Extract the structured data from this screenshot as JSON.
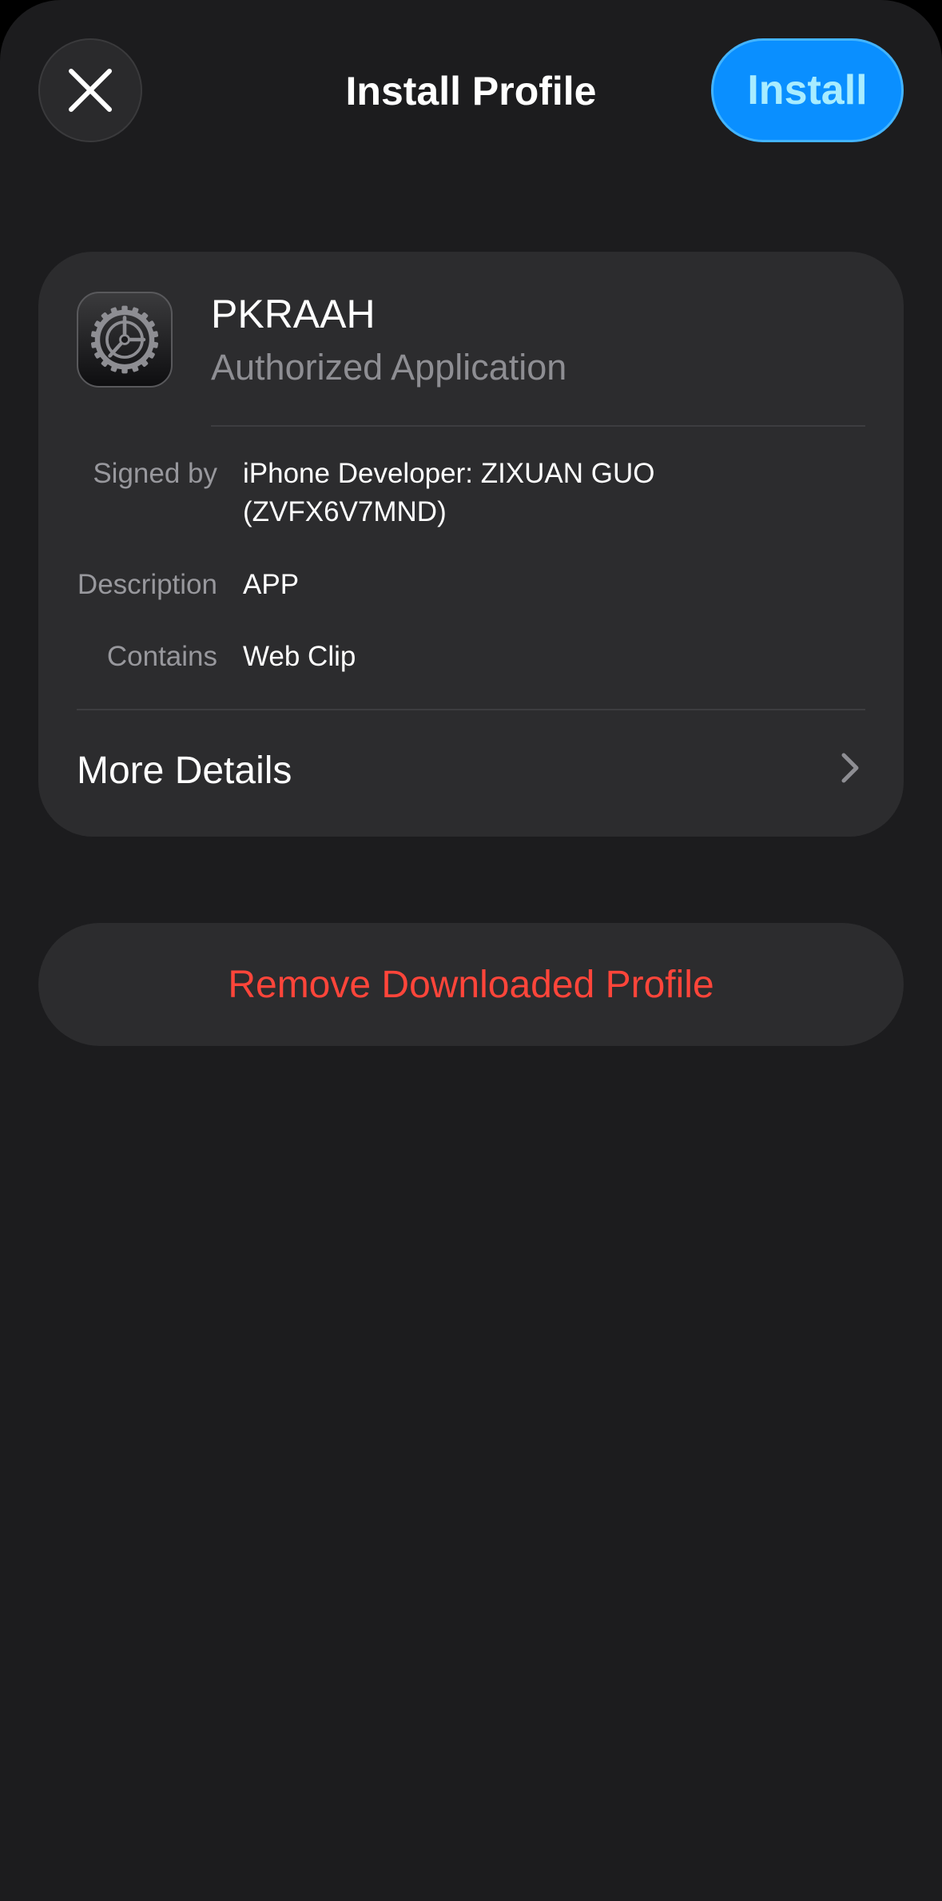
{
  "header": {
    "title": "Install Profile",
    "install_label": "Install",
    "close_icon": "close-icon"
  },
  "profile": {
    "name": "PKRAAH",
    "subtitle": "Authorized Application",
    "icon": "settings-gear-icon",
    "details": [
      {
        "label": "Signed by",
        "value": "iPhone Developer: ZIXUAN GUO (ZVFX6V7MND)"
      },
      {
        "label": "Description",
        "value": "APP"
      },
      {
        "label": "Contains",
        "value": "Web Clip"
      }
    ],
    "more_details_label": "More Details"
  },
  "remove_label": "Remove Downloaded Profile",
  "colors": {
    "background": "#1c1c1e",
    "card": "#2c2c2e",
    "accent": "#0a8fff",
    "destructive": "#ff453a",
    "secondary_text": "#8e8e93"
  }
}
